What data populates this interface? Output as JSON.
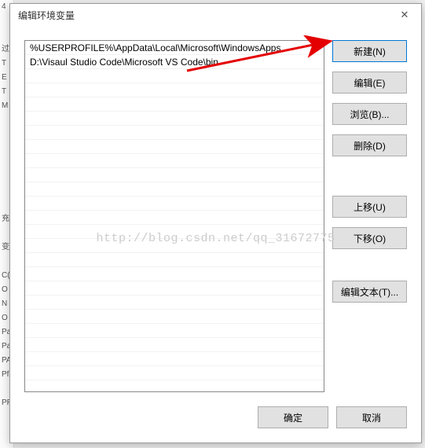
{
  "dialog": {
    "title": "编辑环境变量",
    "close_label": "✕"
  },
  "list": {
    "entries": [
      "%USERPROFILE%\\AppData\\Local\\Microsoft\\WindowsApps",
      "D:\\Visaul Studio Code\\Microsoft VS Code\\bin"
    ]
  },
  "buttons": {
    "new": "新建(N)",
    "edit": "编辑(E)",
    "browse": "浏览(B)...",
    "delete": "删除(D)",
    "move_up": "上移(U)",
    "move_down": "下移(O)",
    "edit_text": "编辑文本(T)...",
    "ok": "确定",
    "cancel": "取消"
  },
  "watermark": "http://blog.csdn.net/qq_31672775",
  "bg_labels": [
    "4",
    "",
    "",
    "过",
    "T",
    "E",
    "T",
    "M",
    "",
    "",
    "",
    "",
    "",
    "",
    "",
    "充",
    "",
    "变",
    "",
    "C(",
    "O",
    "N",
    "O",
    "Pa",
    "Pa",
    "PA",
    "Pf",
    "",
    "PR"
  ]
}
